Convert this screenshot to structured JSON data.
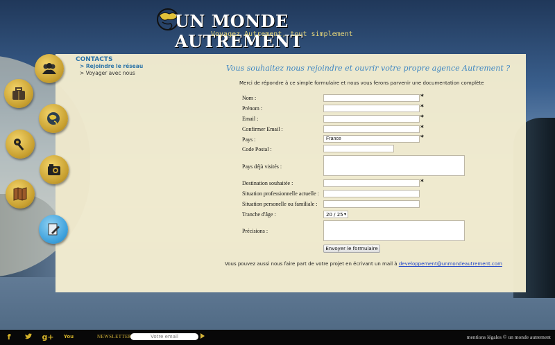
{
  "header": {
    "title": "UN MONDE AUTREMENT",
    "tagline": "Voyagez Autrement, tout simplement"
  },
  "sidebar": {
    "title": "CONTACTS",
    "items": [
      {
        "label": "> Rejoindre le réseau",
        "active": true
      },
      {
        "label": "> Voyager avec nous",
        "active": false
      }
    ]
  },
  "nav_icons": [
    "people-icon",
    "suitcase-icon",
    "globe-icon",
    "key-icon",
    "camera-icon",
    "map-icon",
    "pen-icon"
  ],
  "form": {
    "heading": "Vous souhaitez nous rejoindre et ouvrir votre propre agence Autrement ?",
    "intro": "Merci de répondre à ce simple formulaire et nous vous ferons parvenir une documentation complète",
    "fields": {
      "nom": {
        "label": "Nom :",
        "value": "",
        "required": "*"
      },
      "prenom": {
        "label": "Prénom :",
        "value": "",
        "required": "*"
      },
      "email": {
        "label": "Email :",
        "value": "",
        "required": "*"
      },
      "confirm_email": {
        "label": "Confirmer Email :",
        "value": "",
        "required": "*"
      },
      "pays": {
        "label": "Pays :",
        "value": "France",
        "required": "*"
      },
      "code_postal": {
        "label": "Code Postal :",
        "value": ""
      },
      "pays_visites": {
        "label": "Pays déjà visités :",
        "value": ""
      },
      "destination": {
        "label": "Destination souhaitée :",
        "value": "",
        "required": "*"
      },
      "situation_pro": {
        "label": "Situation professionnelle actuelle :",
        "value": ""
      },
      "situation_perso": {
        "label": "Situation personelle ou familiale :",
        "value": ""
      },
      "tranche_age": {
        "label": "Tranche d'âge :",
        "value": "20 / 25"
      },
      "precisions": {
        "label": "Précisions :",
        "value": ""
      }
    },
    "submit_label": "Envoyer le formulaire",
    "footer_text": "Vous pouvez aussi nous faire part de votre projet en écrivant un mail à",
    "footer_email": "developpement@unmondeautrement.com"
  },
  "bottom": {
    "social": [
      "f",
      "t",
      "g+",
      "You"
    ],
    "newsletter_label": "NEWSLETTER",
    "newsletter_placeholder": "Votre email",
    "legal": "mentions légales © un monde autrement"
  },
  "colors": {
    "accent": "#3d85c2",
    "gold": "#d4b22a",
    "panel": "#f3eccf"
  }
}
